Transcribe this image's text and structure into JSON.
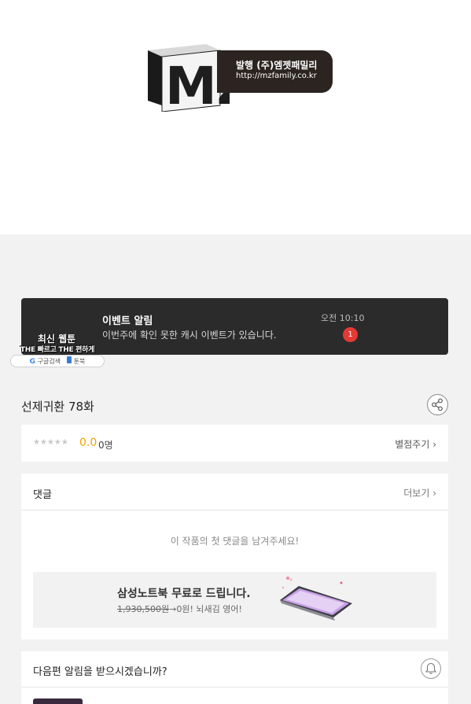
{
  "publisher": {
    "logo_text": "MZ",
    "line1": "발행 (주)엠젯패밀리",
    "line2": "http://mzfamily.co.kr"
  },
  "event": {
    "title": "이벤트 알림",
    "description": "이번주에 확인 못한 캐시 이벤트가 있습니다.",
    "time": "오전 10:10",
    "badge": "1"
  },
  "promo": {
    "line1": "최신 웹툰",
    "line2": "THE 빠르고 THE 편하게",
    "google": "구글검색",
    "book": "툰북"
  },
  "episode": {
    "title": "선제귀환 78화",
    "share_icon": "share-icon"
  },
  "rating": {
    "stars": "★★★★★",
    "score": "0.0",
    "count": "0명",
    "rate_button": "별점주기 ›"
  },
  "comments": {
    "heading": "댓글",
    "more": "더보기 ›",
    "empty_message": "이 작품의 첫 댓글을 남겨주세요!"
  },
  "ad": {
    "title": "삼성노트북 무료로 드립니다.",
    "old_price": "1,930,500원",
    "rest": "→0원! 뇌새김 영어!"
  },
  "notify": {
    "question": "다음편 알림을 받으시겠습니까?",
    "icon": "bell-icon"
  }
}
